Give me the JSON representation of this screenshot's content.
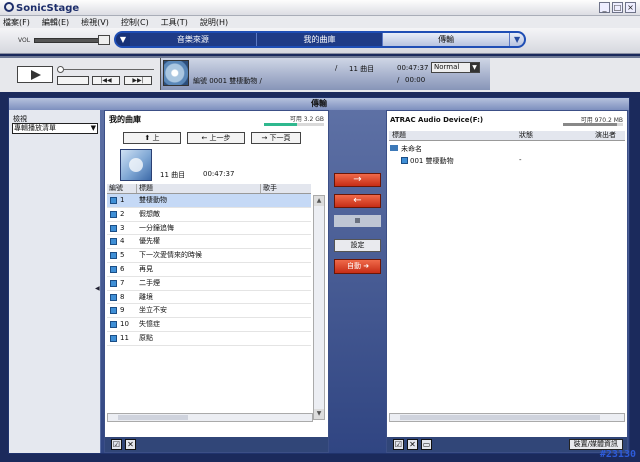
{
  "app": {
    "name": "SonicStage"
  },
  "window_buttons": [
    "_",
    "□",
    "×"
  ],
  "menu": [
    "檔案(F)",
    "編輯(E)",
    "檢視(V)",
    "控制(C)",
    "工具(T)",
    "說明(H)"
  ],
  "volume": {
    "label": "VOL",
    "level": 0.9
  },
  "nav": {
    "tabs": [
      {
        "label": "音樂來源",
        "active": false
      },
      {
        "label": "我的曲庫",
        "active": false
      },
      {
        "label": "傳輸",
        "active": true
      }
    ],
    "left_arrow": "▼",
    "right_arrow": "▼"
  },
  "player": {
    "prev_label": "|◀◀",
    "next_label": "▶▶|",
    "track_info": "編號 0001 雙棲動物 /",
    "slash": "/",
    "track_count": "11 曲目",
    "time_total": "00:47:37",
    "time_elapsed": "00:00",
    "time_slash": "/",
    "mode": "Normal"
  },
  "main_title": "傳輸",
  "left_col": {
    "label": "檢視",
    "select": "專輯播放清單"
  },
  "library_panel": {
    "title": "我的曲庫",
    "capacity_text": "可用 3.2 GB",
    "capacity_fraction": 0.55,
    "btn_up": "上",
    "btn_back": "上一步",
    "btn_next": "下一頁",
    "album": {
      "tracks": "11 曲目",
      "duration": "00:47:37"
    },
    "columns": [
      "編號",
      "標題",
      "歌手"
    ],
    "rows": [
      {
        "num": "1",
        "title": "雙棲動物",
        "selected": true
      },
      {
        "num": "2",
        "title": "假想敵",
        "selected": false
      },
      {
        "num": "3",
        "title": "一分鐘追悔",
        "selected": false
      },
      {
        "num": "4",
        "title": "優先權",
        "selected": false
      },
      {
        "num": "5",
        "title": "下一次愛情來的時候",
        "selected": false
      },
      {
        "num": "6",
        "title": "再見",
        "selected": false
      },
      {
        "num": "7",
        "title": "二手煙",
        "selected": false
      },
      {
        "num": "8",
        "title": "離境",
        "selected": false
      },
      {
        "num": "9",
        "title": "坐立不安",
        "selected": false
      },
      {
        "num": "10",
        "title": "失憶症",
        "selected": false
      },
      {
        "num": "11",
        "title": "原點",
        "selected": false
      }
    ]
  },
  "transfer": {
    "to_device": "→",
    "from_device": "←",
    "settings": "設定",
    "auto": "自動"
  },
  "device_panel": {
    "title": "ATRAC Audio Device(F:)",
    "capacity_text": "可用 970.2 MB",
    "capacity_fraction": 0.9,
    "columns": [
      "標題",
      "狀態",
      "演出者"
    ],
    "folder": "未命名",
    "track": {
      "label": "001 雙棲動物",
      "status": "-"
    },
    "device_info_button": "裝置/媒體資訊"
  },
  "footer_icons": [
    "☑",
    "✕",
    "▭"
  ],
  "watermark": "#23130"
}
